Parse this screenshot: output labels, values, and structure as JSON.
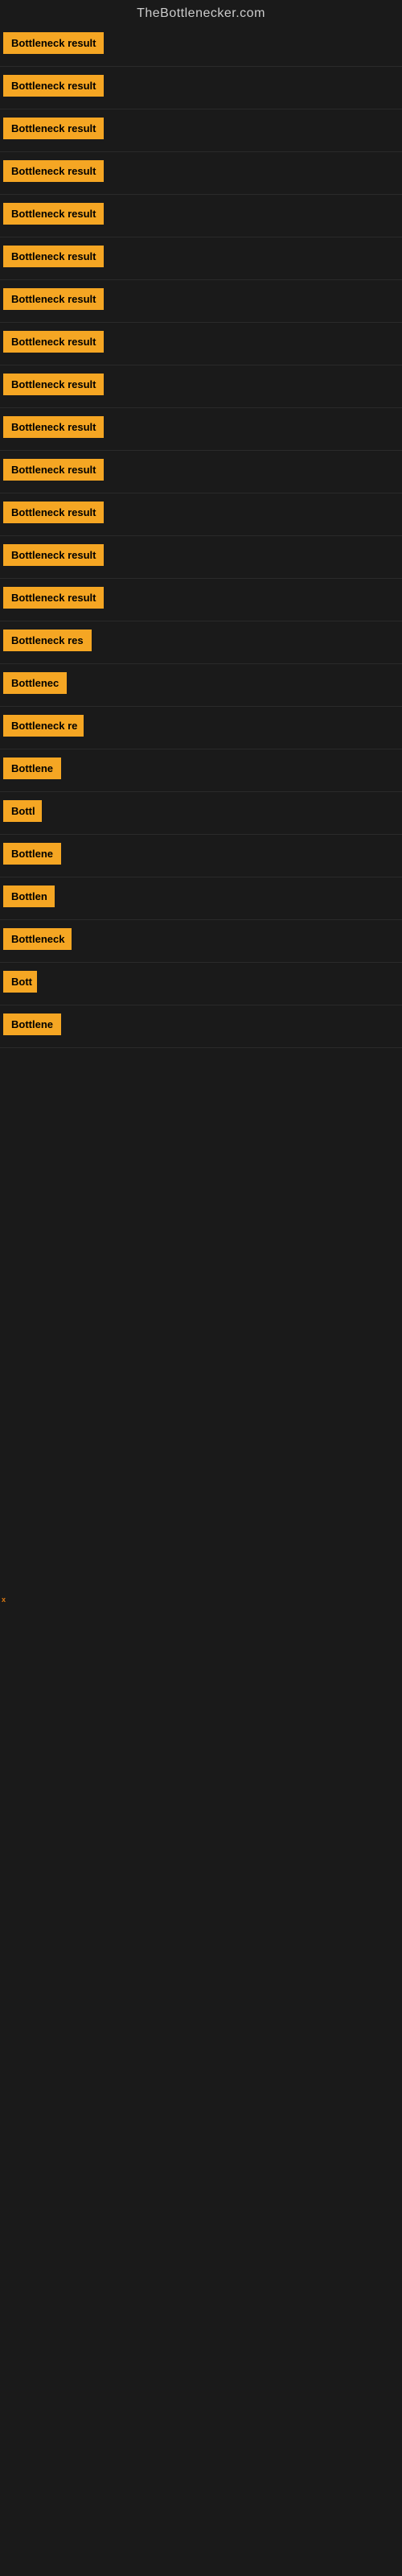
{
  "site": {
    "title": "TheBottlenecker.com"
  },
  "rows": [
    {
      "label": "Bottleneck result",
      "width": 135
    },
    {
      "label": "Bottleneck result",
      "width": 135
    },
    {
      "label": "Bottleneck result",
      "width": 135
    },
    {
      "label": "Bottleneck result",
      "width": 135
    },
    {
      "label": "Bottleneck result",
      "width": 135
    },
    {
      "label": "Bottleneck result",
      "width": 135
    },
    {
      "label": "Bottleneck result",
      "width": 135
    },
    {
      "label": "Bottleneck result",
      "width": 135
    },
    {
      "label": "Bottleneck result",
      "width": 135
    },
    {
      "label": "Bottleneck result",
      "width": 135
    },
    {
      "label": "Bottleneck result",
      "width": 135
    },
    {
      "label": "Bottleneck result",
      "width": 135
    },
    {
      "label": "Bottleneck result",
      "width": 135
    },
    {
      "label": "Bottleneck result",
      "width": 135
    },
    {
      "label": "Bottleneck res",
      "width": 110
    },
    {
      "label": "Bottlenec",
      "width": 80
    },
    {
      "label": "Bottleneck re",
      "width": 100
    },
    {
      "label": "Bottlene",
      "width": 72
    },
    {
      "label": "Bottl",
      "width": 48
    },
    {
      "label": "Bottlene",
      "width": 72
    },
    {
      "label": "Bottlen",
      "width": 64
    },
    {
      "label": "Bottleneck",
      "width": 85
    },
    {
      "label": "Bott",
      "width": 42
    },
    {
      "label": "Bottlene",
      "width": 72
    }
  ],
  "small_label": "x"
}
